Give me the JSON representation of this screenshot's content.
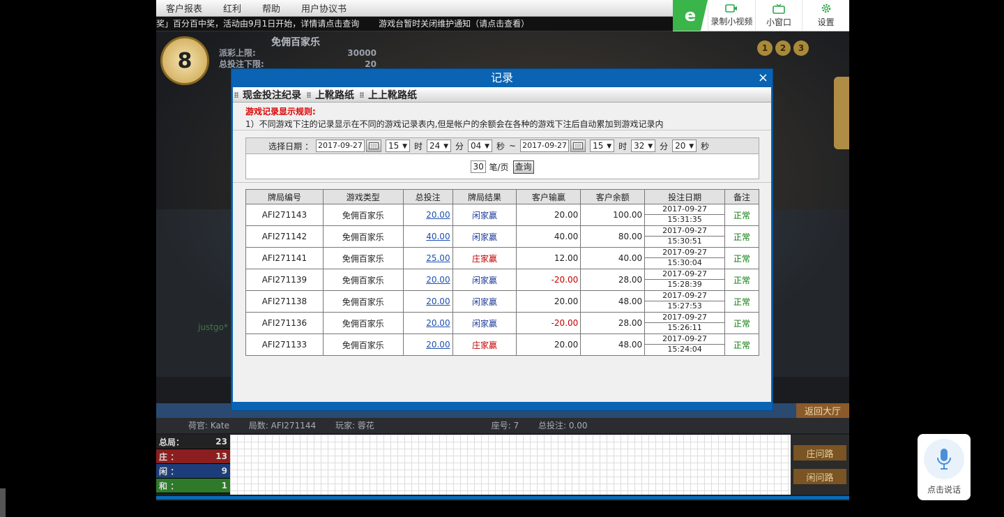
{
  "menu": {
    "items": [
      "客户报表",
      "红利",
      "帮助",
      "用户协议书"
    ]
  },
  "ticker": {
    "items": [
      "奖」百分百中奖，活动由9月1日开始，详情请点击查询",
      "游戏台暂时关闭维护通知（请点击查看）"
    ]
  },
  "toolbar": {
    "logo": "e",
    "record_label": "录制小视频",
    "mini_label": "小窗口",
    "settings_label": "设置"
  },
  "game": {
    "round_number": "8",
    "table_name": "免佣百家乐",
    "limit_rows": [
      {
        "label": "派彩上限:",
        "value": "30000"
      },
      {
        "label": "总投注下限:",
        "value": "20"
      }
    ],
    "nav_pages": [
      "1",
      "2",
      "3"
    ],
    "brand": "justgo*"
  },
  "info_bar": {
    "dealer": "荷官:  Kate",
    "round": "局数:  AFI271144",
    "player": "玩家:  蓉花",
    "seat": "座号:  7",
    "total": "总投注:  0.00"
  },
  "lobby_button": "返回大厅",
  "stats": [
    {
      "label": "总局：",
      "value": "23"
    },
    {
      "label": "庄  ：",
      "value": "13"
    },
    {
      "label": "闲  ：",
      "value": "9"
    },
    {
      "label": "和  ：",
      "value": "1"
    }
  ],
  "road_buttons": [
    "庄问路",
    "闲问路"
  ],
  "voice_label": "点击说话",
  "modal": {
    "title": "记录",
    "close": "×",
    "tabs": [
      "现金投注纪录",
      "上靴路纸",
      "上上靴路纸"
    ],
    "rules_title": "游戏记录显示规则:",
    "rules_line": "1）不同游戏下注的记录显示在不同的游戏记录表内,但是帐户的余额会在各种的游戏下注后自动累加到游戏记录内",
    "filter": {
      "label": "选择日期 ：",
      "from_date": "2017-09-27",
      "from_hour": "15",
      "from_min": "24",
      "from_sec": "04",
      "to_date": "2017-09-27",
      "to_hour": "15",
      "to_min": "32",
      "to_sec": "20",
      "unit_hour": "时",
      "unit_min": "分",
      "unit_sec": "秒",
      "tilde": "~",
      "per_page": "30",
      "per_page_unit": "笔/页",
      "query_button": "查询"
    },
    "columns": [
      "牌局编号",
      "游戏类型",
      "总投注",
      "牌局结果",
      "客户输赢",
      "客户余额",
      "投注日期",
      "备注"
    ],
    "rows": [
      {
        "id": "AFI271143",
        "type": "免佣百家乐",
        "bet": "20.00",
        "result": "闲家赢",
        "result_side": "p",
        "win": "20.00",
        "neg": false,
        "balance": "100.00",
        "date": "2017-09-27",
        "time": "15:31:35",
        "note": "正常"
      },
      {
        "id": "AFI271142",
        "type": "免佣百家乐",
        "bet": "40.00",
        "result": "闲家赢",
        "result_side": "p",
        "win": "40.00",
        "neg": false,
        "balance": "80.00",
        "date": "2017-09-27",
        "time": "15:30:51",
        "note": "正常"
      },
      {
        "id": "AFI271141",
        "type": "免佣百家乐",
        "bet": "25.00",
        "result": "庄家赢",
        "result_side": "b",
        "win": "12.00",
        "neg": false,
        "balance": "40.00",
        "date": "2017-09-27",
        "time": "15:30:04",
        "note": "正常"
      },
      {
        "id": "AFI271139",
        "type": "免佣百家乐",
        "bet": "20.00",
        "result": "闲家赢",
        "result_side": "p",
        "win": "-20.00",
        "neg": true,
        "balance": "28.00",
        "date": "2017-09-27",
        "time": "15:28:39",
        "note": "正常"
      },
      {
        "id": "AFI271138",
        "type": "免佣百家乐",
        "bet": "20.00",
        "result": "闲家赢",
        "result_side": "p",
        "win": "20.00",
        "neg": false,
        "balance": "48.00",
        "date": "2017-09-27",
        "time": "15:27:53",
        "note": "正常"
      },
      {
        "id": "AFI271136",
        "type": "免佣百家乐",
        "bet": "20.00",
        "result": "闲家赢",
        "result_side": "p",
        "win": "-20.00",
        "neg": true,
        "balance": "28.00",
        "date": "2017-09-27",
        "time": "15:26:11",
        "note": "正常"
      },
      {
        "id": "AFI271133",
        "type": "免佣百家乐",
        "bet": "20.00",
        "result": "庄家赢",
        "result_side": "b",
        "win": "20.00",
        "neg": false,
        "balance": "48.00",
        "date": "2017-09-27",
        "time": "15:24:04",
        "note": "正常"
      }
    ]
  }
}
